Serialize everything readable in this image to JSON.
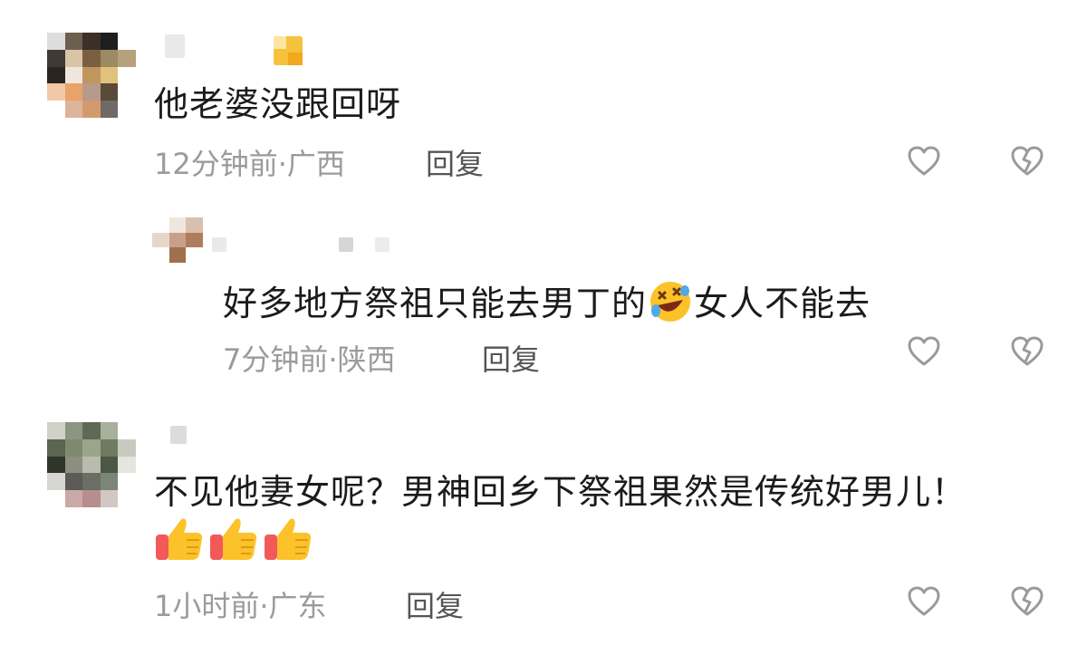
{
  "comments": [
    {
      "text": "他老婆没跟回呀",
      "time": "12分钟前",
      "separator": "·",
      "location": "广西",
      "reply_label": "回复"
    },
    {
      "text_before": "好多地方祭祖只能去男丁的",
      "emoji": "rolling-on-floor-laughing",
      "text_after": "女人不能去",
      "time": "7分钟前",
      "separator": "·",
      "location": "陕西",
      "reply_label": "回复"
    },
    {
      "text": "不见他妻女呢？男神回乡下祭祖果然是传统好男儿！",
      "emojis": [
        "thumbs-up",
        "thumbs-up",
        "thumbs-up"
      ],
      "time": "1小时前",
      "separator": "·",
      "location": "广东",
      "reply_label": "回复"
    }
  ],
  "icons": {
    "like": "heart-icon",
    "dislike": "broken-heart-icon"
  },
  "colors": {
    "text": "#1b1b1b",
    "meta": "#9b9b9b",
    "icon": "#9a9a9a",
    "badge": "#f5c23b"
  }
}
